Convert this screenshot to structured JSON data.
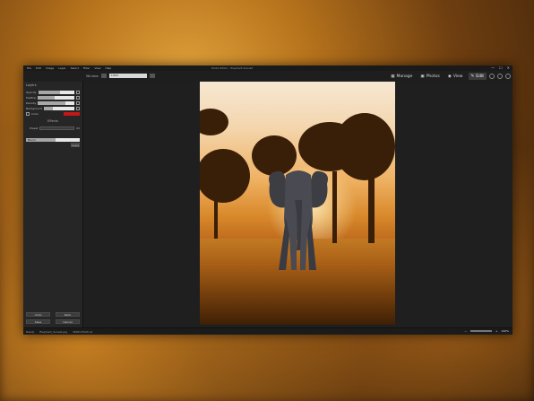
{
  "app": {
    "title": "Photo Editor - Elephant Sunset",
    "menu": [
      "File",
      "Edit",
      "Image",
      "Layer",
      "Select",
      "Filter",
      "View",
      "Help"
    ],
    "window_controls": [
      "—",
      "☐",
      "✕"
    ]
  },
  "toolbar": {
    "view_label": "Window",
    "view_value": "100%",
    "modes": [
      {
        "label": "Manage",
        "icon": "grid-icon",
        "active": false
      },
      {
        "label": "Photos",
        "icon": "photos-icon",
        "active": false
      },
      {
        "label": "View",
        "icon": "eye-icon",
        "active": false
      },
      {
        "label": "Edit",
        "icon": "edit-icon",
        "active": true
      }
    ]
  },
  "left_panel": {
    "header": "Layers",
    "rows": [
      {
        "label": "Opacity",
        "value": 0.6
      },
      {
        "label": "Feather",
        "value": 0.45
      },
      {
        "label": "Density",
        "value": 0.75
      },
      {
        "label": "Background",
        "value": 0.3
      }
    ],
    "color_label": "Color",
    "section_title": "Effects",
    "preset_label": "Preset",
    "blend_label": "Blend",
    "blend_value": 0.55,
    "apply_label": "Apply",
    "bottom_buttons": [
      "Undo",
      "Redo",
      "Save",
      "Cancel"
    ]
  },
  "status": {
    "left": "Ready",
    "file": "Elephant_Sunset.jpg",
    "info": "3680×5520 px",
    "zoom": "100%"
  }
}
